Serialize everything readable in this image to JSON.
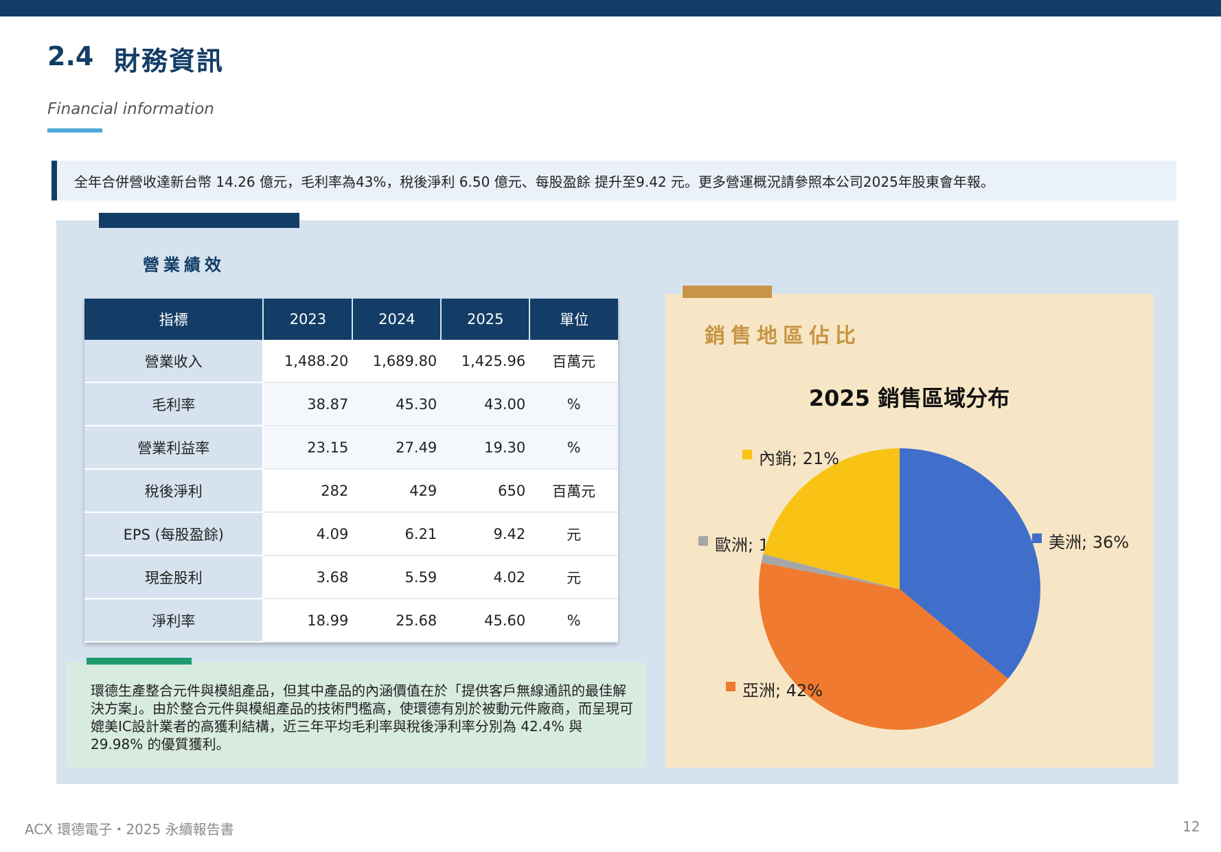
{
  "header": {
    "section_number": "2.4",
    "section_title": "財務資訊",
    "section_subtitle": "Financial information"
  },
  "summary": "全年合併營收達新台幣 14.26 億元，毛利率為43%，稅後淨利 6.50 億元、每股盈餘 提升至9.42 元。更多營運概況請參照本公司2025年股東會年報。",
  "performance": {
    "title": "營業績效",
    "columns": [
      "指標",
      "2023",
      "2024",
      "2025",
      "單位"
    ],
    "rows": [
      {
        "label": "營業收入",
        "v2023": "1,488.20",
        "v2024": "1,689.80",
        "v2025": "1,425.96",
        "unit": "百萬元"
      },
      {
        "label": "毛利率",
        "v2023": "38.87",
        "v2024": "45.30",
        "v2025": "43.00",
        "unit": "%"
      },
      {
        "label": "營業利益率",
        "v2023": "23.15",
        "v2024": "27.49",
        "v2025": "19.30",
        "unit": "%"
      },
      {
        "label": "稅後淨利",
        "v2023": "282",
        "v2024": "429",
        "v2025": "650",
        "unit": "百萬元"
      },
      {
        "label": "EPS (每股盈餘)",
        "v2023": "4.09",
        "v2024": "6.21",
        "v2025": "9.42",
        "unit": "元"
      },
      {
        "label": "現金股利",
        "v2023": "3.68",
        "v2024": "5.59",
        "v2025": "4.02",
        "unit": "元"
      },
      {
        "label": "淨利率",
        "v2023": "18.99",
        "v2024": "25.68",
        "v2025": "45.60",
        "unit": "%"
      }
    ]
  },
  "note": "環德生產整合元件與模組產品，但其中產品的內涵價值在於「提供客戶無線通訊的最佳解決方案」。由於整合元件與模組產品的技術門檻高，使環德有別於被動元件廠商，而呈現可媲美IC設計業者的高獲利結構，近三年平均毛利率與稅後淨利率分別為 42.4% 與 29.98% 的優質獲利。",
  "sales": {
    "title": "銷售地區佔比"
  },
  "chart_data": {
    "type": "pie",
    "title": "2025 銷售區域分布",
    "categories": [
      "美洲",
      "亞洲",
      "歐洲",
      "內銷"
    ],
    "values": [
      36,
      42,
      1,
      21
    ],
    "labels": [
      "美洲; 36%",
      "亞洲; 42%",
      "歐洲; 1%",
      "內銷; 21%"
    ],
    "colors": [
      "#3f6fcb",
      "#ef7a30",
      "#a6a6a6",
      "#f8c315"
    ],
    "legend": "none"
  },
  "footer": {
    "left": "ACX 環德電子・2025 永續報告書",
    "page": "12"
  }
}
